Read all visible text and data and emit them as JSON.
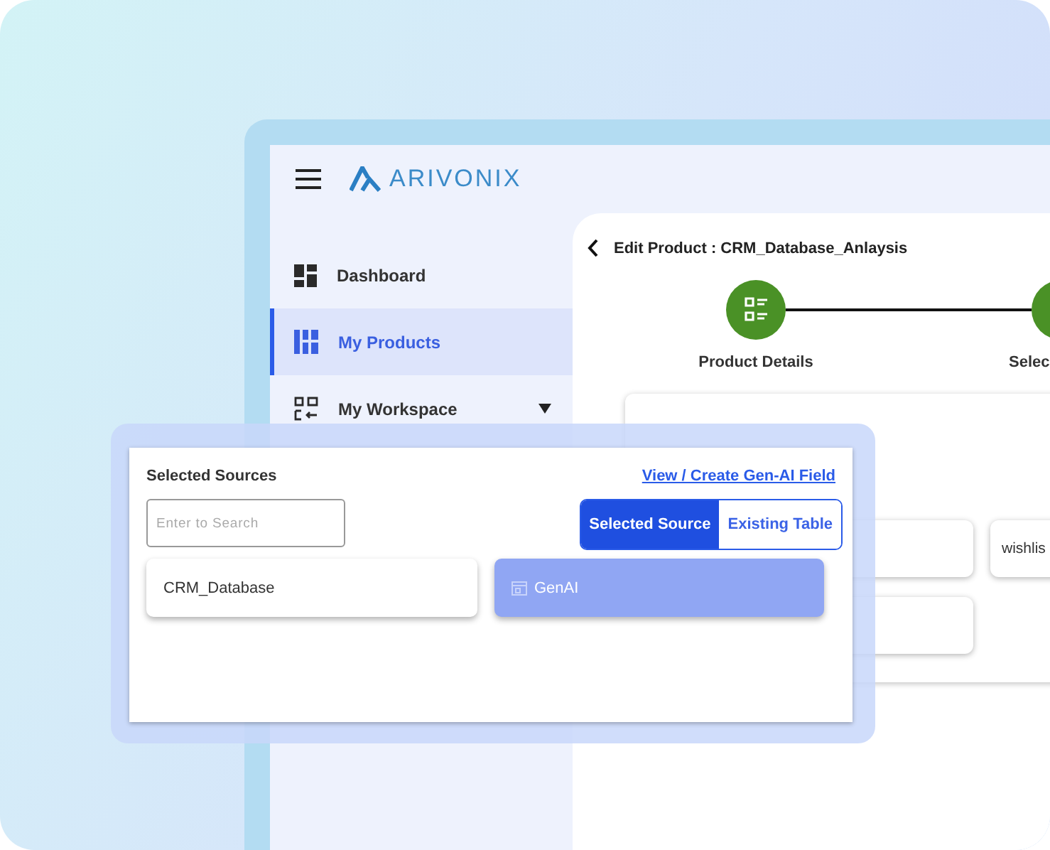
{
  "app": {
    "logo": "ARIVONIX"
  },
  "sidebar": {
    "items": [
      {
        "label": "Dashboard",
        "selected": false,
        "expandable": false
      },
      {
        "label": "My Products",
        "selected": true,
        "expandable": false
      },
      {
        "label": "My Workspace",
        "selected": false,
        "expandable": true
      }
    ]
  },
  "page": {
    "title": "Edit Product : CRM_Database_Anlaysis",
    "steps": [
      {
        "label": "Product Details"
      },
      {
        "label": "Selec"
      }
    ],
    "tables": [
      {
        "name": "wishlis"
      }
    ]
  },
  "popup": {
    "title": "Selected Sources",
    "link": "View / Create Gen-AI Field",
    "search": {
      "placeholder": "Enter to Search"
    },
    "toggle": [
      {
        "label": "Selected Source",
        "selected": true
      },
      {
        "label": "Existing Table",
        "selected": false
      }
    ],
    "sources": [
      {
        "name": "CRM_Database",
        "kind": "database",
        "selected": false
      },
      {
        "name": "GenAI",
        "kind": "gen-ai",
        "selected": true
      }
    ]
  }
}
